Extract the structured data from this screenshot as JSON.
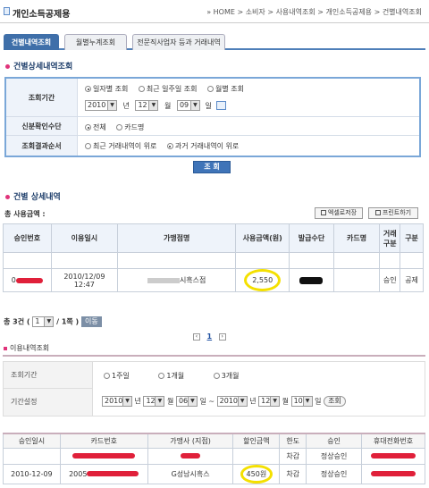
{
  "header": {
    "title": "개인소득공제용",
    "breadcrumb": "» HOME > 소비자 > 사용내역조회 > 개인소득공제용 > 건별내역조회"
  },
  "tabs": [
    {
      "label": "건별내역조회",
      "active": true
    },
    {
      "label": "월별누계조회",
      "active": false
    },
    {
      "label": "전문직사업자 등과 거래내역",
      "active": false
    }
  ],
  "query_section": {
    "title": "건별상세내역조회",
    "period_label": "조회기간",
    "period_options": [
      "일자별 조회",
      "최근 일주일 조회",
      "월별 조회"
    ],
    "period_selected": "일자별 조회",
    "year": "2010",
    "year_unit": "년",
    "month": "12",
    "month_unit": "월",
    "day": "09",
    "day_unit": "일",
    "id_method_label": "신분확인수단",
    "id_options": [
      "전체",
      "카드명"
    ],
    "id_selected": "전체",
    "order_label": "조회결과순서",
    "order_options": [
      "최근 거래내역이 위로",
      "과거 거래내역이 위로"
    ],
    "order_selected": "과거 거래내역이 위로",
    "search_label": "조 회"
  },
  "detail_section": {
    "title": "건별 상세내역",
    "total_label": "총 사용금액 :",
    "excel_button": "엑셀로저장",
    "print_button": "프린트하기",
    "columns": [
      "승인번호",
      "이용일시",
      "가맹점명",
      "사용금액(원)",
      "발급수단",
      "카드명",
      "거래구분",
      "구분"
    ],
    "rows": [
      {
        "approval": "0",
        "datetime": "2010/12/09 12:47",
        "merchant": "시흑스점",
        "amount": "2,550",
        "issuer": "",
        "card": "",
        "trade": "승인",
        "type": "공제"
      }
    ],
    "count_text": "총 3건 (",
    "page_select": "1",
    "page_total": "/ 1쪽 )",
    "go_button": "이동",
    "pages": [
      "1"
    ],
    "current_page": "1"
  },
  "usage_section": {
    "title": "이용내역조회",
    "period_label": "조회기간",
    "period_options": [
      "1주일",
      "1개월",
      "3개월"
    ],
    "setting_label": "기간설정",
    "from_year": "2010",
    "from_month": "12",
    "from_day": "06",
    "to_year": "2010",
    "to_month": "12",
    "to_day": "10",
    "unit_year": "년",
    "unit_month": "월",
    "unit_day": "일",
    "range_sep": "~",
    "search_label": "조회",
    "columns": [
      "승인일시",
      "카드번호",
      "가맹사 (지점)",
      "할인금액",
      "한도",
      "승인",
      "휴대전화번호"
    ],
    "rows": [
      {
        "date": "",
        "card": "",
        "merchant": "",
        "discount": "",
        "limit": "차감",
        "status": "정상승인",
        "phone": ""
      },
      {
        "date": "2010-12-09",
        "card": "2005",
        "merchant": "G성남시흑스",
        "discount": "450원",
        "limit": "차감",
        "status": "정상승인",
        "phone": ""
      }
    ]
  },
  "colors": {
    "accent": "#3f6fa9",
    "highlight": "#f4e000",
    "redaction": "#e0203a"
  }
}
